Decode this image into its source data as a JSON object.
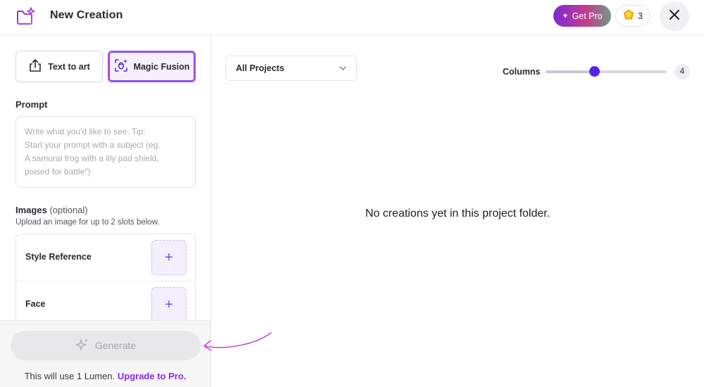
{
  "header": {
    "title": "New Creation",
    "get_pro_label": "Get Pro",
    "lumen_count": "3",
    "icons": {
      "logo": "folder-sparkle-icon",
      "close": "close-icon",
      "lumen": "gem-icon"
    }
  },
  "sidebar": {
    "modes": [
      {
        "label": "Text to art",
        "icon": "upload-icon",
        "selected": false
      },
      {
        "label": "Magic Fusion",
        "icon": "face-scan-icon",
        "selected": true
      }
    ],
    "prompt": {
      "label": "Prompt",
      "placeholder": "Write what you'd like to see.  Tip: Start your prompt with a subject (eg. A samurai frog with a lily pad shield, poised for battle\")",
      "placeholder_lines": [
        "Write what you'd like to see.  Tip:",
        "Start your prompt with a subject (eg.",
        "A samurai frog with a lily pad shield,",
        "poised for battle\")"
      ]
    },
    "images": {
      "label": "Images",
      "optional": "(optional)",
      "hint": "Upload an image for up to 2 slots below.",
      "slots": [
        {
          "label": "Style Reference",
          "add": "+"
        },
        {
          "label": "Face",
          "add": "+"
        }
      ]
    },
    "generate": {
      "label": "Generate",
      "cost_note": "This will use 1 Lumen.",
      "upgrade": "Upgrade to Pro."
    }
  },
  "main": {
    "project_filter": "All Projects",
    "columns_label": "Columns",
    "columns_value": 4,
    "columns_min": 1,
    "columns_max": 10,
    "empty_message": "No creations yet in this project folder."
  },
  "colors": {
    "accent": "#5b21e6",
    "selected_border": "#b44fe0",
    "upgrade_link": "#8a2be2",
    "arrow": "#c24fd6"
  }
}
